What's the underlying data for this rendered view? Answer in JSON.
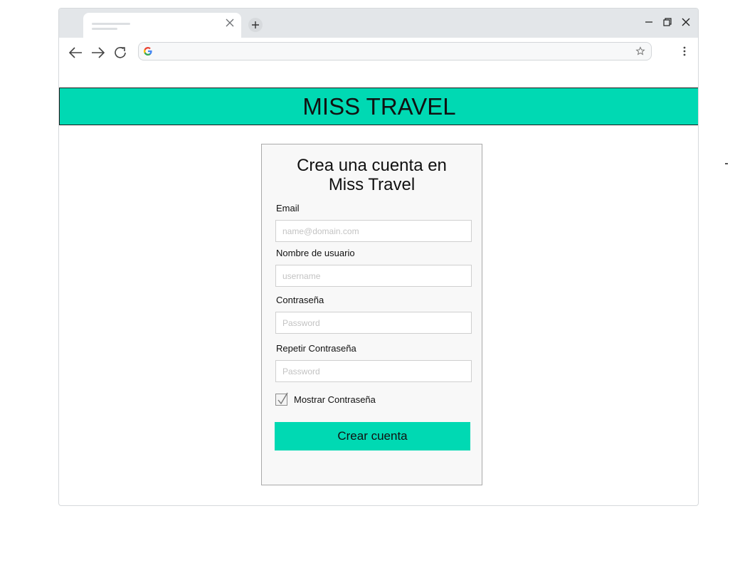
{
  "browser": {
    "tab_close_icon": "close-icon",
    "new_tab_icon": "plus-icon",
    "address_value": "",
    "window_controls": [
      "minimize-icon",
      "restore-icon",
      "close-icon"
    ],
    "nav_icons": [
      "arrow-left-icon",
      "arrow-right-icon",
      "reload-icon"
    ]
  },
  "header": {
    "title": "MISS TRAVEL",
    "bg_color": "#00d9b3"
  },
  "form": {
    "title_line1": "Crea una cuenta en",
    "title_line2": "Miss Travel",
    "email_label": "Email",
    "email_placeholder": "name@domain.com",
    "username_label": "Nombre de usuario",
    "username_placeholder": "username",
    "password_label": "Contraseña",
    "password_placeholder": "Password",
    "repeat_label": "Repetir Contraseña",
    "repeat_placeholder": "Password",
    "show_password_label": "Mostrar Contraseña",
    "show_password_checked": true,
    "submit_label": "Crear cuenta",
    "accent_color": "#00d9b3"
  }
}
